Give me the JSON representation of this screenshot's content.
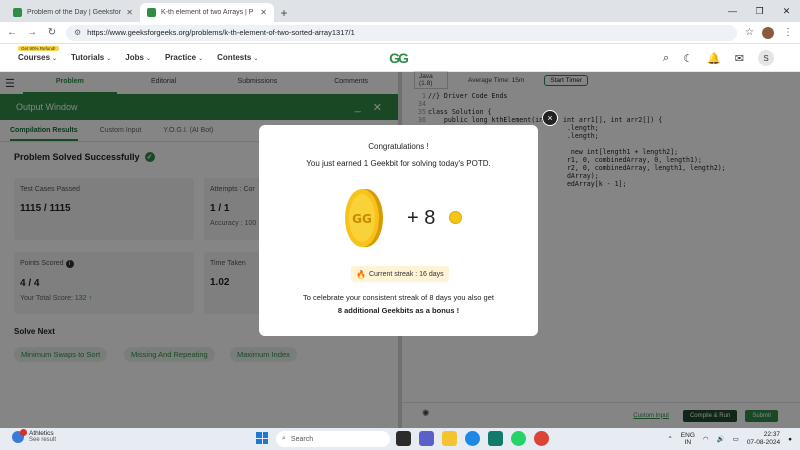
{
  "browser": {
    "tabs": [
      {
        "title": "Problem of the Day | Geeksfor",
        "active": false
      },
      {
        "title": "K-th element of two Arrays | P",
        "active": true
      }
    ],
    "url": "https://www.geeksforgeeks.org/problems/k-th-element-of-two-sorted-array1317/1",
    "window_controls": [
      "minimize",
      "maximize",
      "close"
    ]
  },
  "site_header": {
    "badge": "Get 90% Refund!",
    "nav": [
      "Courses",
      "Tutorials",
      "Jobs",
      "Practice",
      "Contests"
    ],
    "logo_text": "GG",
    "avatar_letter": "S"
  },
  "problem_tabs": [
    "Problem",
    "Editorial",
    "Submissions",
    "Comments"
  ],
  "output_window": {
    "title": "Output Window",
    "tabs": [
      "Compilation Results",
      "Custom Input",
      "Y.O.G.I. (AI Bot)"
    ],
    "status": "Problem Solved Successfully",
    "cards": {
      "test_cases": {
        "label": "Test Cases Passed",
        "value": "1115 / 1115"
      },
      "attempts": {
        "label": "Attempts : Cor",
        "value": "1 / 1",
        "sub": "Accuracy : 100"
      },
      "points": {
        "label": "Points Scored",
        "value": "4 / 4",
        "sub_label": "Your Total Score:",
        "sub_value": "132 ↑"
      },
      "time": {
        "label": "Time Taken",
        "value": "1.02"
      }
    },
    "solve_next_title": "Solve Next",
    "solve_next": [
      "Minimum Swaps to Sort",
      "Missing And Repeating",
      "Maximum Index"
    ]
  },
  "editor": {
    "language": "Java (1.8)",
    "avg_time": "Average Time: 15m",
    "timer_label": "Start Timer",
    "code_lines": [
      {
        "n": "1",
        "t": "//} Driver Code Ends"
      },
      {
        "n": "34",
        "t": ""
      },
      {
        "n": "35",
        "t": "class Solution {"
      },
      {
        "n": "36",
        "t": "    public long kthElement(int k, int arr1[], int arr2[]) {"
      },
      {
        "n": "",
        "t": "                                   .length;"
      },
      {
        "n": "",
        "t": "                                   .length;"
      },
      {
        "n": "",
        "t": ""
      },
      {
        "n": "",
        "t": "                                    new int[length1 + length2];"
      },
      {
        "n": "",
        "t": "                                   r1, 0, combinedArray, 0, length1);"
      },
      {
        "n": "",
        "t": "                                   r2, 0, combinedArray, length1, length2);"
      },
      {
        "n": "",
        "t": "                                   dArray);"
      },
      {
        "n": "",
        "t": "                                   edArray[k - 1];"
      }
    ],
    "footer": {
      "custom_input": "Custom Input",
      "compile": "Compile & Run",
      "submit": "Submit"
    }
  },
  "modal": {
    "title": "Congratulations !",
    "message": "You just earned 1 Geekbit for solving today's POTD.",
    "plus": "+ 8",
    "streak": "Current streak : 16 days",
    "footer_line1": "To celebrate your consistent streak of 8 days you also get",
    "footer_line2": "8 additional Geekbits as a bonus !",
    "close_symbol": "×"
  },
  "taskbar": {
    "weather_title": "Athletics",
    "weather_sub": "See result",
    "search_placeholder": "Search",
    "lang_line1": "ENG",
    "lang_line2": "IN",
    "time": "22:37",
    "date": "07-08-2024"
  },
  "colors": {
    "brand_green": "#2f8d46",
    "overlay": "rgba(0,0,0,0.48)"
  }
}
